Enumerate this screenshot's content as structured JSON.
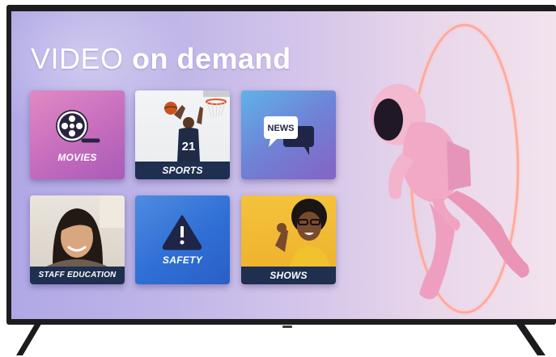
{
  "title": {
    "part1": "VIDEO",
    "part2": "on demand"
  },
  "tiles": [
    {
      "label": "MOVIES",
      "icon": "film-reel-icon"
    },
    {
      "label": "SPORTS",
      "icon": "basketball-player-photo"
    },
    {
      "label": "NEWS",
      "icon": "news-chat-bubbles-icon"
    },
    {
      "label": "STAFF EDUCATION",
      "icon": "woman-portrait-photo"
    },
    {
      "label": "SAFETY",
      "icon": "warning-triangle-icon"
    },
    {
      "label": "SHOWS",
      "icon": "smiling-man-photo"
    }
  ],
  "colors": {
    "caption_bar": "#1e2f4f",
    "background_left": "#b0a8e6",
    "background_right": "#f2e3ee",
    "movies_tile": "#c56cbd",
    "news_tile": "#6f82d6",
    "safety_tile": "#2f6fd5",
    "shows_tile": "#eeb02a",
    "ring": "#ff9a8a"
  }
}
